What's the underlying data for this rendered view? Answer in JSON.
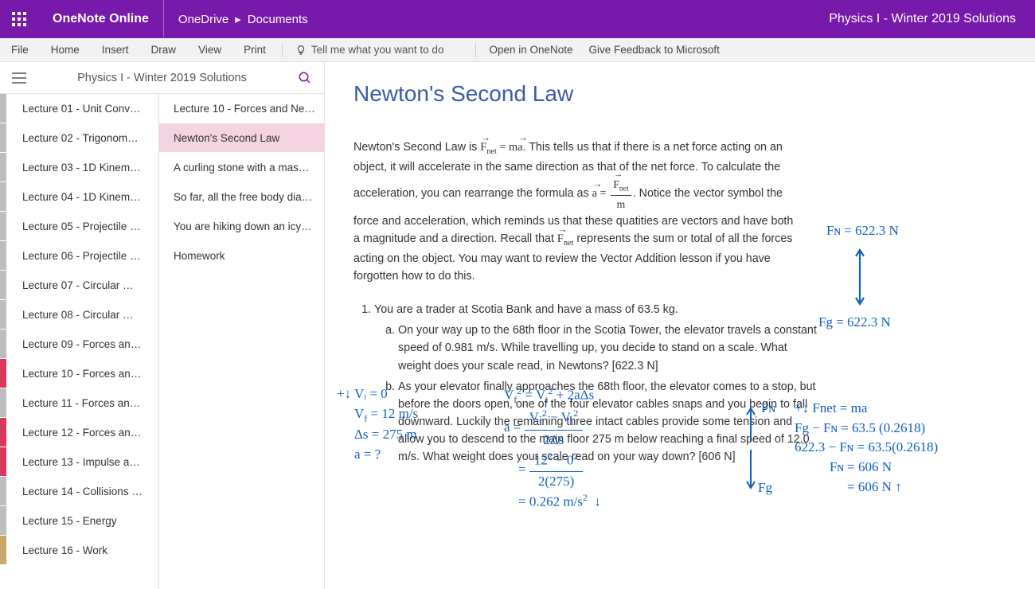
{
  "header": {
    "app_name": "OneNote Online",
    "breadcrumb_root": "OneDrive",
    "breadcrumb_folder": "Documents",
    "notebook_title": "Physics I - Winter 2019 Solutions"
  },
  "ribbon": {
    "tabs": [
      "File",
      "Home",
      "Insert",
      "Draw",
      "View",
      "Print"
    ],
    "tell_me_placeholder": "Tell me what you want to do",
    "right_links": [
      "Open in OneNote",
      "Give Feedback to Microsoft"
    ]
  },
  "nav": {
    "title": "Physics I - Winter 2019 Solutions",
    "sections": [
      {
        "label": "Lecture 01 - Unit Conv…",
        "color": "#bdbdbd"
      },
      {
        "label": "Lecture 02 - Trigonom…",
        "color": "#bdbdbd"
      },
      {
        "label": "Lecture 03 - 1D Kinem…",
        "color": "#bdbdbd"
      },
      {
        "label": "Lecture 04 - 1D Kinem…",
        "color": "#bdbdbd"
      },
      {
        "label": "Lecture 05 - Projectile …",
        "color": "#bdbdbd"
      },
      {
        "label": "Lecture 06 - Projectile …",
        "color": "#bdbdbd"
      },
      {
        "label": "Lecture 07 - Circular …",
        "color": "#bdbdbd"
      },
      {
        "label": "Lecture 08 - Circular …",
        "color": "#bdbdbd"
      },
      {
        "label": "Lecture 09 - Forces an…",
        "color": "#bdbdbd"
      },
      {
        "label": "Lecture 10 - Forces an…",
        "color": "#D93A5B",
        "active": true
      },
      {
        "label": "Lecture 11 - Forces an…",
        "color": "#bdbdbd"
      },
      {
        "label": "Lecture 12 - Forces an…",
        "color": "#D93A5B"
      },
      {
        "label": "Lecture 13 - Impulse a…",
        "color": "#D93A5B"
      },
      {
        "label": "Lecture 14 - Collisions …",
        "color": "#bdbdbd"
      },
      {
        "label": "Lecture 15 - Energy",
        "color": "#bdbdbd"
      },
      {
        "label": "Lecture 16 - Work",
        "color": "#C9A86A"
      }
    ],
    "pages": [
      {
        "label": "Lecture 10 - Forces and Ne…"
      },
      {
        "label": "Newton's Second Law",
        "active": true
      },
      {
        "label": "A curling stone with a mas…"
      },
      {
        "label": "So far, all the free body dia…"
      },
      {
        "label": "You are hiking down an icy…"
      },
      {
        "label": "Homework"
      }
    ]
  },
  "page": {
    "title": "Newton's Second Law",
    "para_intro_pre": "Newton's Second Law is ",
    "para_intro_post": ". This tells us that if there is a net force acting on an object, it will accelerate in the same direction as that of the net force. To calculate the acceleration, you can rearrange the formula as ",
    "para_intro_tail": ".  Notice the vector symbol the force and acceleration, which reminds us that these quatities are vectors and have both a magnitude and a direction. Recall that ",
    "para_intro_end": " represents the sum or total of all the forces acting on the object. You may want to review the Vector Addition lesson if you have forgotten how to do this.",
    "problem1_stem": "You are a trader at Scotia Bank and have a mass of 63.5 kg.",
    "problem1a": "On your way up to the 68th floor in the Scotia Tower, the elevator travels a constant speed of 0.981 m/s. While travelling up, you decide to stand on a scale. What weight does your scale read, in Newtons? [622.3 N]",
    "problem1b": "As your elevator finally approaches the 68th floor, the elevator comes to a stop, but before the doors open, one of the four elevator cables snaps and you begin to fall downward. Luckily the remaining three intact cables provide some tension and allow you to descend to the main floor 275 m below reaching a final speed of 12.0 m/s. What weight does your scale read on your way down? [606 N]"
  },
  "handwriting": {
    "fbd1_fn": "Fɴ = 622.3 N",
    "fbd1_fg": "Fg = 622.3 N",
    "givens_l1": "+↓ Vᵢ = 0",
    "givens_l2": "V_f = 12 m/s",
    "givens_l3": "Δs = 275 m",
    "givens_l4": "a = ?",
    "kin_l1": "V_f² = Vᵢ² + 2aΔs",
    "kin_l2": "a = (V_f² − Vᵢ²) / 2Δs",
    "kin_l3": "= (12² − 0²) / 2(275)",
    "kin_l4": "= 0.262 m/s²  ↓",
    "fbd2_fn": "Fɴ",
    "fbd2_fg": "Fg",
    "newton_l1": "+↓ Fnet = ma",
    "newton_l2": "Fg − Fɴ = 63.5 (0.2618)",
    "newton_l3": "622.3 − Fɴ = 63.5(0.2618)",
    "newton_l4": "Fɴ = 606 N",
    "newton_l5": "= 606 N  ↑"
  }
}
